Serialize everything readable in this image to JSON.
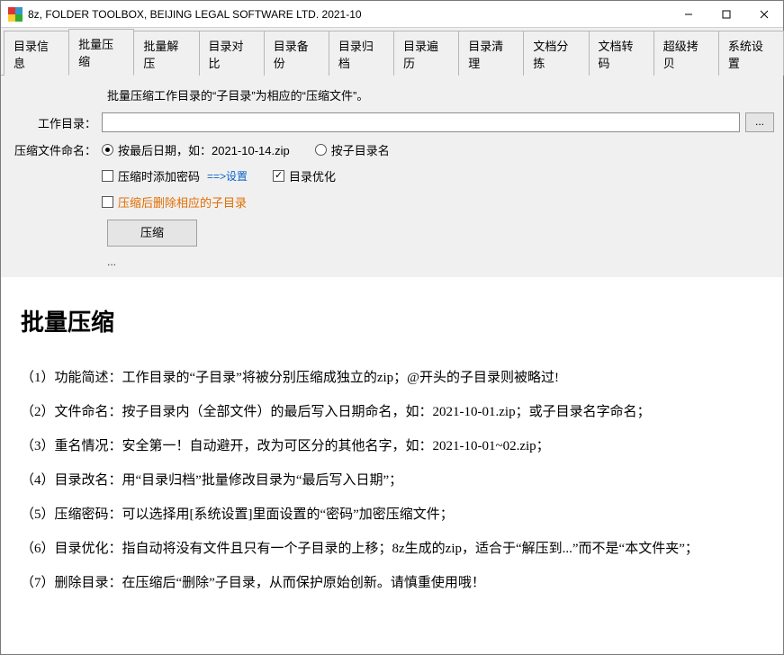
{
  "window": {
    "title": "8z, FOLDER TOOLBOX, BEIJING LEGAL SOFTWARE LTD. 2021-10"
  },
  "tabs": [
    "目录信息",
    "批量压缩",
    "批量解压",
    "目录对比",
    "目录备份",
    "目录归档",
    "目录遍历",
    "目录清理",
    "文档分拣",
    "文档转码",
    "超级拷贝",
    "系统设置"
  ],
  "active_tab_index": 1,
  "form": {
    "description": "批量压缩工作目录的“子目录”为相应的“压缩文件”。",
    "workdir_label": "工作目录：",
    "workdir_value": "",
    "browse_label": "...",
    "naming_label": "压缩文件命名：",
    "radio_by_date_label": "按最后日期，如：2021-10-14.zip",
    "radio_by_dirname_label": "按子目录名",
    "radio_selected": "by_date",
    "check_password_label": "压缩时添加密码",
    "password_link": "==>设置",
    "check_optimize_label": "目录优化",
    "check_optimize_checked": true,
    "check_delete_label": "压缩后删除相应的子目录",
    "compress_button": "压缩",
    "status": "..."
  },
  "doc": {
    "title": "批量压缩",
    "items": [
      "（1）功能简述：工作目录的“子目录”将被分别压缩成独立的zip；@开头的子目录则被略过!",
      "（2）文件命名：按子目录内（全部文件）的最后写入日期命名，如：2021-10-01.zip；或子目录名字命名；",
      "（3）重名情况：安全第一！自动避开，改为可区分的其他名字，如：2021-10-01~02.zip；",
      "（4）目录改名：用“目录归档”批量修改目录为“最后写入日期”；",
      "（5）压缩密码：可以选择用[系统设置]里面设置的“密码”加密压缩文件；",
      "（6）目录优化：指自动将没有文件且只有一个子目录的上移；8z生成的zip，适合于“解压到...”而不是“本文件夹”；",
      "（7）删除目录：在压缩后“删除”子目录，从而保护原始创新。请慎重使用哦！"
    ]
  }
}
